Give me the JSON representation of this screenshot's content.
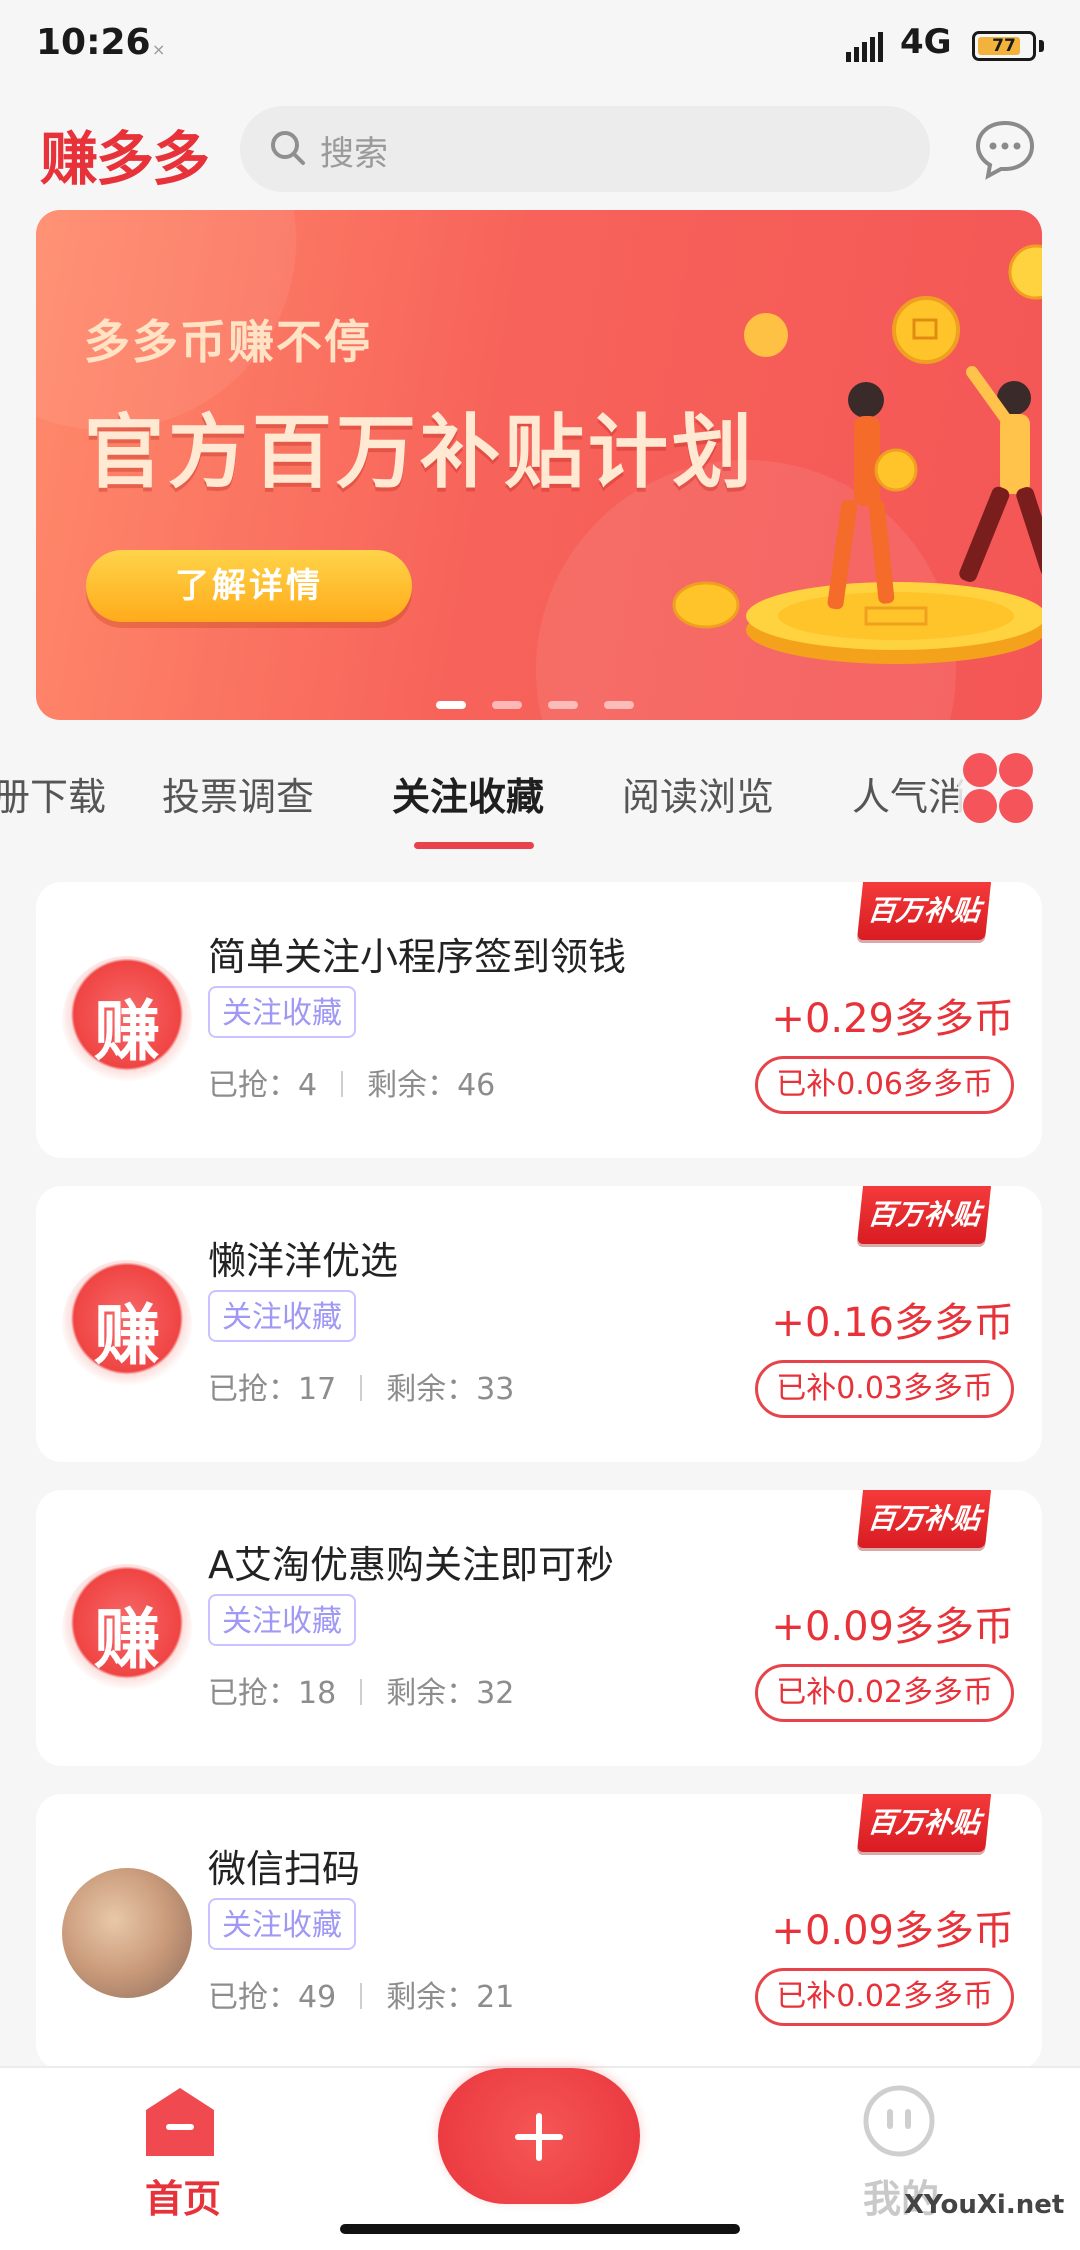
{
  "status_bar": {
    "time": "10:26",
    "network": "4G",
    "battery": "77"
  },
  "header": {
    "logo": "赚多多",
    "search_placeholder": "搜索"
  },
  "banner": {
    "subtitle": "多多币赚不停",
    "title": "官方百万补贴计划",
    "button": "了解详情",
    "slide_count": 4,
    "active_slide": 0
  },
  "tabs": [
    "册下载",
    "投票调查",
    "关注收藏",
    "阅读浏览",
    "人气消"
  ],
  "active_tab": 2,
  "tasks": [
    {
      "title": "简单关注小程序签到领钱",
      "tag": "关注收藏",
      "grabbed": "已抢：4",
      "remaining": "剩余：46",
      "reward": "+0.29多多币",
      "subsidy": "已补0.06多多币",
      "badge": "百万补贴",
      "avatar": "赚"
    },
    {
      "title": "懒洋洋优选",
      "tag": "关注收藏",
      "grabbed": "已抢：17",
      "remaining": "剩余：33",
      "reward": "+0.16多多币",
      "subsidy": "已补0.03多多币",
      "badge": "百万补贴",
      "avatar": "赚"
    },
    {
      "title": "A艾淘优惠购关注即可秒",
      "tag": "关注收藏",
      "grabbed": "已抢：18",
      "remaining": "剩余：32",
      "reward": "+0.09多多币",
      "subsidy": "已补0.02多多币",
      "badge": "百万补贴",
      "avatar": "赚"
    },
    {
      "title": "微信扫码",
      "tag": "关注收藏",
      "grabbed": "已抢：49",
      "remaining": "剩余：21",
      "reward": "+0.09多多币",
      "subsidy": "已补0.02多多币",
      "badge": "百万补贴",
      "avatar": ""
    }
  ],
  "bottom_nav": {
    "home": "首页",
    "mine": "我的"
  },
  "watermark": "XYouXi.net",
  "colors": {
    "accent": "#e8323a",
    "tag_border": "#c9c3ff",
    "tag_text": "#9f98f5",
    "background": "#f6f6f7"
  }
}
